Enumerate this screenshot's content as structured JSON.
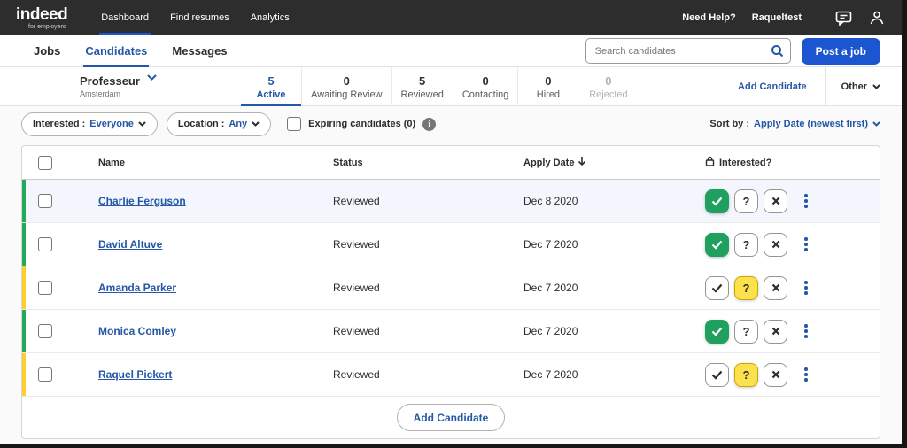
{
  "colors": {
    "link_blue": "#2557a7",
    "button_blue": "#1b55d0",
    "green": "#1fa05f",
    "edge_green": "#23a85c",
    "edge_yellow": "#ffce2e",
    "yellow_fill": "#fbe24c"
  },
  "topbar": {
    "logo": "indeed",
    "logo_sub": "for employers",
    "nav": [
      {
        "label": "Dashboard",
        "active": true
      },
      {
        "label": "Find resumes",
        "active": false
      },
      {
        "label": "Analytics",
        "active": false
      }
    ],
    "need_help": "Need Help?",
    "account_name": "Raqueltest"
  },
  "subnav": {
    "tabs": [
      {
        "label": "Jobs",
        "active": false
      },
      {
        "label": "Candidates",
        "active": true
      },
      {
        "label": "Messages",
        "active": false
      }
    ],
    "search_placeholder": "Search candidates",
    "post_job_label": "Post a job"
  },
  "job": {
    "title": "Professeur",
    "location": "Amsterdam"
  },
  "pipeline": {
    "stages": [
      {
        "count": "5",
        "label": "Active"
      },
      {
        "count": "0",
        "label": "Awaiting Review"
      },
      {
        "count": "5",
        "label": "Reviewed"
      },
      {
        "count": "0",
        "label": "Contacting"
      },
      {
        "count": "0",
        "label": "Hired"
      },
      {
        "count": "0",
        "label": "Rejected"
      }
    ],
    "add_candidate_label": "Add Candidate",
    "other_label": "Other"
  },
  "filters": {
    "interested_prefix": "Interested :",
    "interested_value": "Everyone",
    "location_prefix": "Location :",
    "location_value": "Any",
    "expiring_label": "Expiring candidates (0)",
    "sort_prefix": "Sort by :",
    "sort_value": "Apply Date (newest first)"
  },
  "table": {
    "columns": {
      "name": "Name",
      "status": "Status",
      "apply_date": "Apply Date",
      "interested": "Interested?"
    },
    "rows": [
      {
        "name": "Charlie Ferguson",
        "status": "Reviewed",
        "apply_date": "Dec 8 2020",
        "interested": "yes",
        "edge": "green",
        "highlight": true
      },
      {
        "name": "David Altuve",
        "status": "Reviewed",
        "apply_date": "Dec 7 2020",
        "interested": "yes",
        "edge": "green",
        "highlight": false
      },
      {
        "name": "Amanda Parker",
        "status": "Reviewed",
        "apply_date": "Dec 7 2020",
        "interested": "maybe",
        "edge": "yellow",
        "highlight": false
      },
      {
        "name": "Monica Comley",
        "status": "Reviewed",
        "apply_date": "Dec 7 2020",
        "interested": "yes",
        "edge": "green",
        "highlight": false
      },
      {
        "name": "Raquel Pickert",
        "status": "Reviewed",
        "apply_date": "Dec 7 2020",
        "interested": "maybe",
        "edge": "yellow",
        "highlight": false
      }
    ],
    "footer_button": "Add Candidate"
  }
}
